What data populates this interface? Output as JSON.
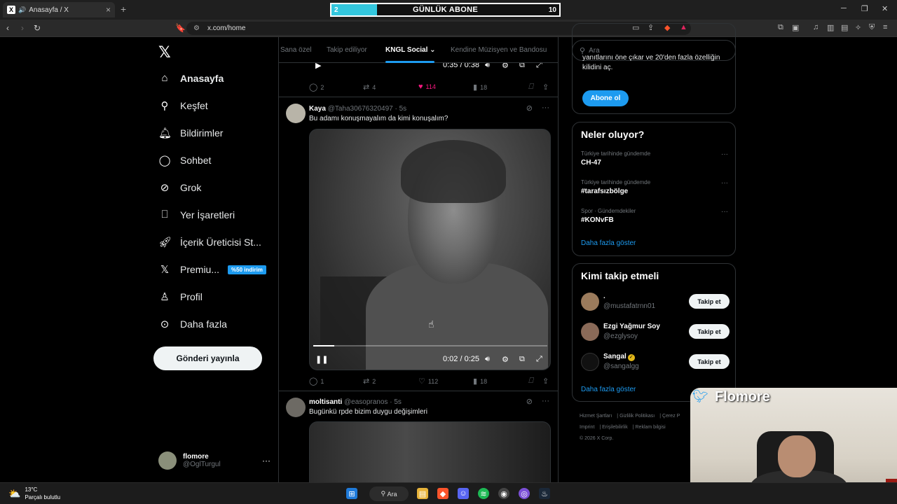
{
  "browser": {
    "tab_title": "Anasayfa / X",
    "url": "x.com/home"
  },
  "overlay": {
    "label": "GÜNLÜK ABONE",
    "current": "2",
    "goal": "10",
    "progress_fraction": 0.2
  },
  "nav": {
    "items": [
      {
        "icon": "home-icon",
        "label": "Anasayfa"
      },
      {
        "icon": "search-icon",
        "label": "Keşfet"
      },
      {
        "icon": "bell-icon",
        "label": "Bildirimler"
      },
      {
        "icon": "chat-icon",
        "label": "Sohbet"
      },
      {
        "icon": "grok-icon",
        "label": "Grok"
      },
      {
        "icon": "bookmark-icon",
        "label": "Yer İşaretleri"
      },
      {
        "icon": "rocket-icon",
        "label": "İçerik Üreticisi St..."
      },
      {
        "icon": "x-premium-icon",
        "label": "Premiu..."
      },
      {
        "icon": "person-icon",
        "label": "Profil"
      },
      {
        "icon": "more-circle-icon",
        "label": "Daha fazla"
      }
    ],
    "premium_badge": "%50 indirim",
    "post_button": "Gönderi yayınla",
    "account": {
      "name": "flomore",
      "handle": "@OglTurgul"
    }
  },
  "feed": {
    "tabs": [
      "Sana özel",
      "Takip ediliyor",
      "KNGL Social",
      "Kendine Müzisyen ve Bandosu"
    ],
    "prev_post": {
      "video_time": "0:35 / 0:38",
      "replies": "2",
      "reposts": "4",
      "likes": "114",
      "views": "18"
    },
    "post1": {
      "name": "Kaya",
      "handle": "@Taha30676320497 · 5s",
      "text": "Bu adamı konuşmayalım da kimi konuşalım?",
      "video_time": "0:02 / 0:25",
      "replies": "1",
      "reposts": "2",
      "likes": "112",
      "views": "18"
    },
    "post2": {
      "name": "moltisanti",
      "handle": "@easopranos · 5s",
      "text": "Bugünkü rpde bizim duygu değişimleri"
    }
  },
  "right": {
    "search_placeholder": "Ara",
    "premium_text": "yanıtlarını öne çıkar ve 20'den fazla özelliğin kilidini aç.",
    "subscribe_button": "Abone ol",
    "trends_title": "Neler oluyor?",
    "trends": [
      {
        "context": "Türkiye tarihinde gündemde",
        "topic": "CH-47"
      },
      {
        "context": "Türkiye tarihinde gündemde",
        "topic": "#tarafsızbölge"
      },
      {
        "context": "Spor · Gündemdekiler",
        "topic": "#KONvFB"
      }
    ],
    "show_more": "Daha fazla göster",
    "who_title": "Kimi takip etmeli",
    "who": [
      {
        "name": ".",
        "handle": "@mustafatrnn01",
        "button": "Takip et"
      },
      {
        "name": "Ezgi Yağmur Soy",
        "handle": "@ezglysoy",
        "button": "Takip et"
      },
      {
        "name": "Sangal",
        "handle": "@sangalgg",
        "button": "Takip et"
      }
    ],
    "who_show_more": "Daha fazla göster",
    "footer": [
      "Hizmet Şartları",
      "Gizlilik Politikası",
      "Çerez P",
      "Imprint",
      "Erişilebilirlik",
      "Reklam bilgisi",
      "© 2026 X Corp."
    ]
  },
  "webcam": {
    "name": "Flomore"
  },
  "taskbar": {
    "temp": "13°C",
    "weather": "Parçalı bulutlu",
    "search": "Ara"
  }
}
